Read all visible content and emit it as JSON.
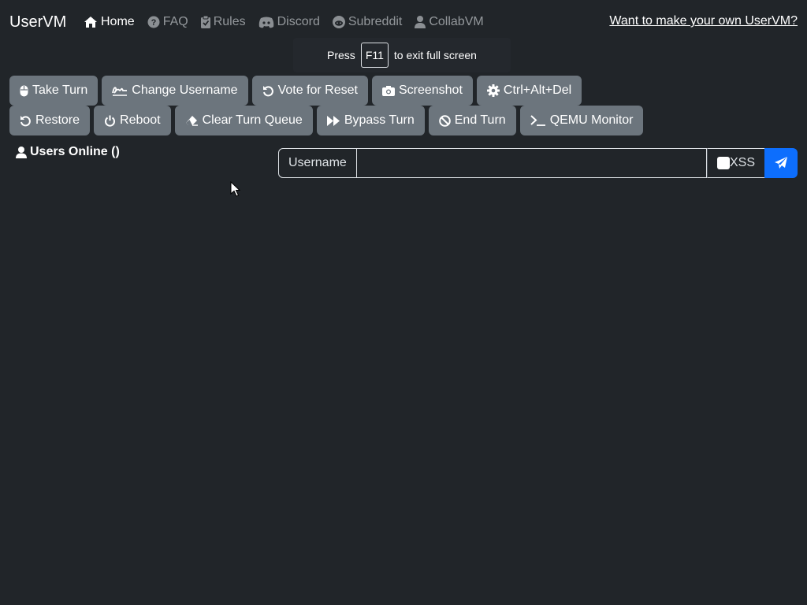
{
  "navbar": {
    "brand": "UserVM",
    "items": [
      {
        "label": "Home",
        "icon": "home-icon"
      },
      {
        "label": "FAQ",
        "icon": "question-circle-icon"
      },
      {
        "label": "Rules",
        "icon": "clipboard-check-icon"
      },
      {
        "label": "Discord",
        "icon": "discord-icon"
      },
      {
        "label": "Subreddit",
        "icon": "reddit-icon"
      },
      {
        "label": "CollabVM",
        "icon": "user-icon"
      }
    ],
    "right_link": "Want to make your own UserVM?"
  },
  "fullscreen_hint": {
    "prefix": "Press",
    "key": "F11",
    "suffix": "to exit full screen"
  },
  "buttons": {
    "row1": [
      {
        "label": "Take Turn",
        "icon": "mouse-icon"
      },
      {
        "label": "Change Username",
        "icon": "signature-icon"
      },
      {
        "label": "Vote for Reset",
        "icon": "undo-icon"
      },
      {
        "label": "Screenshot",
        "icon": "camera-icon"
      },
      {
        "label": "Ctrl+Alt+Del",
        "icon": "gear-icon"
      }
    ],
    "row2": [
      {
        "label": "Restore",
        "icon": "undo-icon"
      },
      {
        "label": "Reboot",
        "icon": "power-icon"
      },
      {
        "label": "Clear Turn Queue",
        "icon": "eraser-icon"
      },
      {
        "label": "Bypass Turn",
        "icon": "fast-forward-icon"
      },
      {
        "label": "End Turn",
        "icon": "ban-icon"
      },
      {
        "label": "QEMU Monitor",
        "icon": "terminal-icon"
      }
    ]
  },
  "users_online": "Users Online ()",
  "chat": {
    "label": "Username",
    "value": "",
    "xss_label": "XSS",
    "xss_checked": false,
    "send_icon": "paper-plane-icon"
  },
  "colors": {
    "background": "#212529",
    "button": "#6c757d",
    "primary": "#0d6efd"
  }
}
